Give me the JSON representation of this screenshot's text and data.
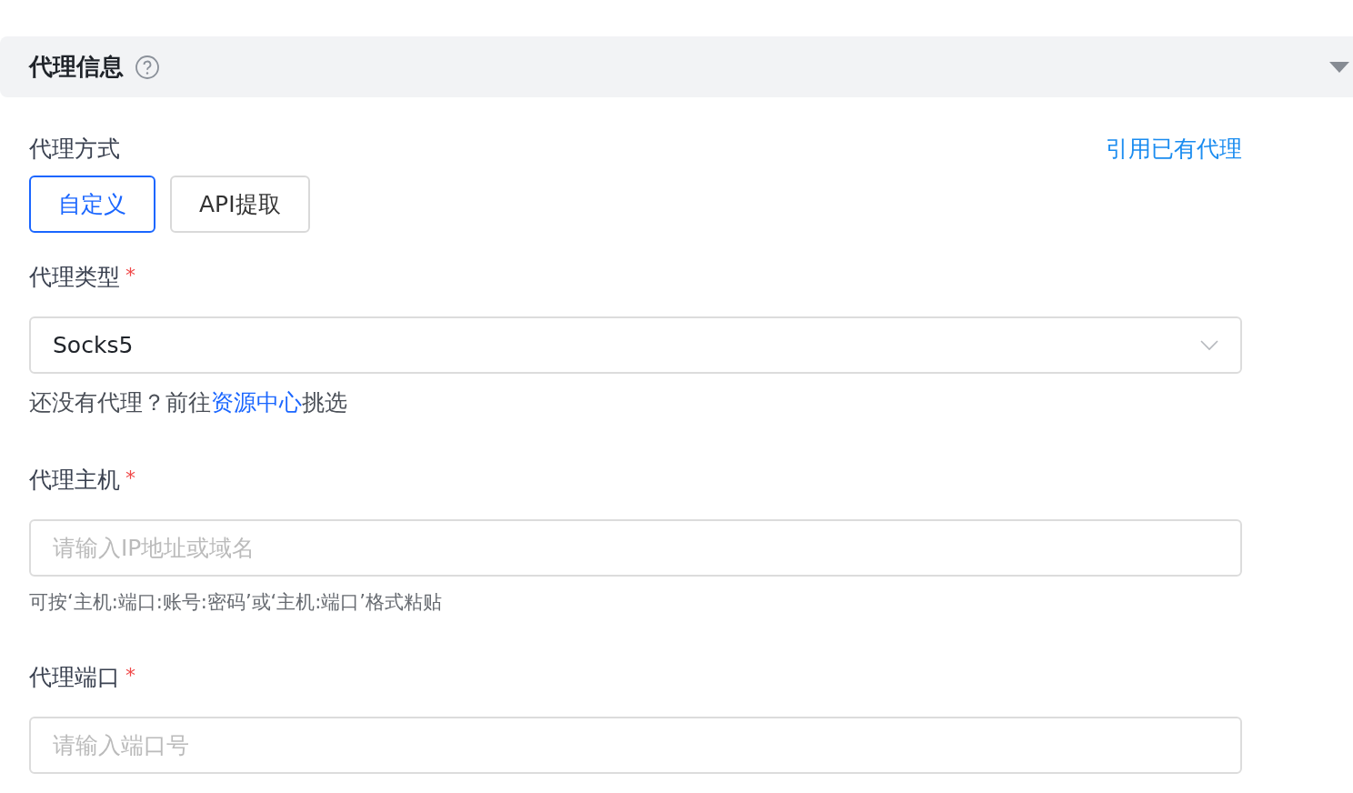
{
  "section": {
    "title": "代理信息",
    "expanded": true
  },
  "fields": [
    {
      "kind": "buttons",
      "label": "代理方式",
      "action_link": "引用已有代理",
      "options": [
        {
          "label": "自定义",
          "selected": true
        },
        {
          "label": "API提取",
          "selected": false
        }
      ]
    },
    {
      "kind": "select",
      "label": "代理类型",
      "asterisk": "*",
      "value": "Socks5",
      "hint": {
        "before": "还没有代理？前往",
        "link": "资源中心",
        "after": "挑选"
      }
    },
    {
      "kind": "input",
      "label": "代理主机",
      "asterisk": "*",
      "placeholder": "请输入IP地址或域名",
      "help": "可按‘主机:端口:账号:密码’或‘主机:端口’格式粘贴"
    },
    {
      "kind": "input",
      "label": "代理端口",
      "asterisk": "*",
      "placeholder": "请输入端口号"
    }
  ]
}
